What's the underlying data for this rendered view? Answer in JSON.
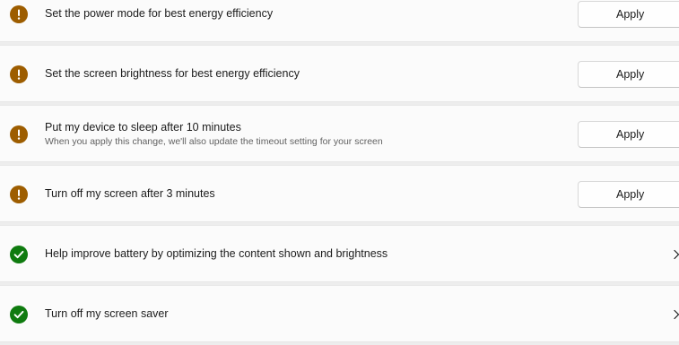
{
  "recommendations": [
    {
      "title": "Set the power mode for best energy efficiency",
      "status": "warning",
      "action": "Apply"
    },
    {
      "title": "Set the screen brightness for best energy efficiency",
      "status": "warning",
      "action": "Apply"
    },
    {
      "title": "Put my device to sleep after 10 minutes",
      "subtitle": "When you apply this change, we'll also update the timeout setting for your screen",
      "status": "warning",
      "action": "Apply"
    },
    {
      "title": "Turn off my screen after 3 minutes",
      "status": "warning",
      "action": "Apply"
    },
    {
      "title": "Help improve battery by optimizing the content shown and brightness",
      "status": "done",
      "action_icon": "chevron-right-icon"
    },
    {
      "title": "Turn off my screen saver",
      "status": "done",
      "action_icon": "chevron-right-icon"
    }
  ],
  "colors": {
    "warning": "#9d5d00",
    "done": "#0f7b0f",
    "page_background": "#ededed",
    "card_background": "#fbfbfb"
  }
}
